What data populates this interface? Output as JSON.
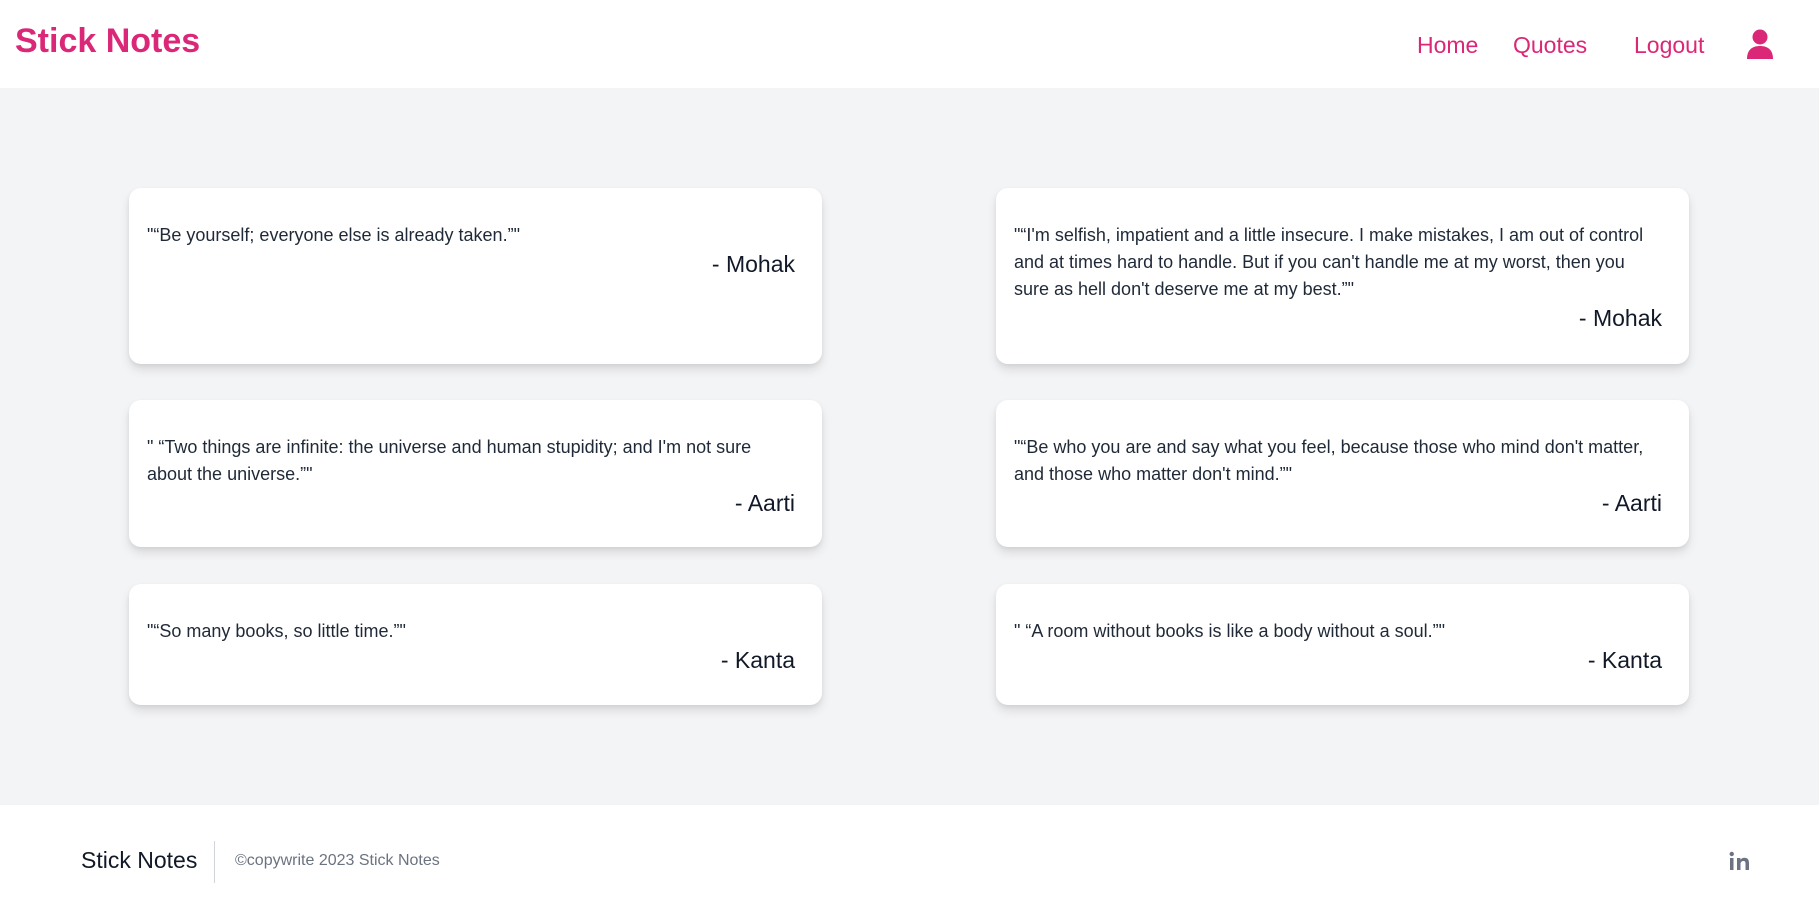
{
  "header": {
    "brand": "Stick Notes",
    "nav": {
      "home": "Home",
      "quotes": "Quotes",
      "logout": "Logout"
    },
    "user_icon": "user-icon",
    "accent_color": "#db2777"
  },
  "quotes": [
    {
      "text": "\"“Be yourself; everyone else is already taken.”\"",
      "author": "- Mohak"
    },
    {
      "text": "\"“I'm selfish, impatient and a little insecure. I make mistakes, I am out of control and at times hard to handle. But if you can't handle me at my worst, then you sure as hell don't deserve me at my best.”\"",
      "author": "- Mohak"
    },
    {
      "text": "\" “Two things are infinite: the universe and human stupidity; and I'm not sure about the universe.”\"",
      "author": "- Aarti"
    },
    {
      "text": "\"“Be who you are and say what you feel, because those who mind don't matter, and those who matter don't mind.”\"",
      "author": "- Aarti"
    },
    {
      "text": "\"“So many books, so little time.”\"",
      "author": "- Kanta"
    },
    {
      "text": "\" “A room without books is like a body without a soul.”\"",
      "author": "- Kanta"
    }
  ],
  "footer": {
    "brand": "Stick Notes",
    "copyright": "©copywrite 2023 Stick Notes",
    "social_icon": "linkedin-icon"
  }
}
